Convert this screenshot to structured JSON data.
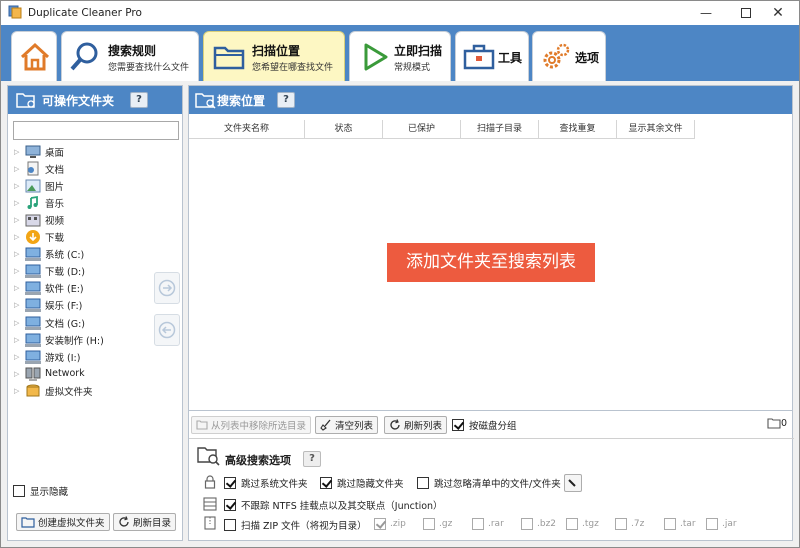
{
  "window": {
    "title": "Duplicate Cleaner Pro"
  },
  "tabs": [
    {
      "title": "搜索规则",
      "subtitle": "您需要查找什么文件"
    },
    {
      "title": "扫描位置",
      "subtitle": "您希望在哪查找文件"
    },
    {
      "title": "立即扫描",
      "subtitle": "常规模式"
    },
    {
      "title": "工具",
      "subtitle": ""
    },
    {
      "title": "选项",
      "subtitle": ""
    }
  ],
  "left_panel": {
    "title": "可操作文件夹",
    "help": "?",
    "tree": [
      {
        "label": "桌面",
        "icon": "desktop-icon"
      },
      {
        "label": "文档",
        "icon": "documents-icon"
      },
      {
        "label": "图片",
        "icon": "pictures-icon"
      },
      {
        "label": "音乐",
        "icon": "music-icon"
      },
      {
        "label": "视频",
        "icon": "video-icon"
      },
      {
        "label": "下载",
        "icon": "download-icon"
      },
      {
        "label": "系统 (C:)",
        "icon": "drive-icon"
      },
      {
        "label": "下载 (D:)",
        "icon": "drive-icon"
      },
      {
        "label": "软件 (E:)",
        "icon": "drive-icon"
      },
      {
        "label": "娱乐 (F:)",
        "icon": "drive-icon"
      },
      {
        "label": "文档 (G:)",
        "icon": "drive-icon"
      },
      {
        "label": "安装制作 (H:)",
        "icon": "drive-icon"
      },
      {
        "label": "游戏 (I:)",
        "icon": "drive-icon"
      },
      {
        "label": "Network",
        "icon": "network-icon"
      },
      {
        "label": "虚拟文件夹",
        "icon": "virtual-folder-icon"
      }
    ],
    "show_hidden": "显示隐藏",
    "create_virtual": "创建虚拟文件夹",
    "refresh_dir": "刷新目录"
  },
  "right_panel": {
    "title": "搜索位置",
    "help": "?",
    "columns": [
      "文件夹名称",
      "状态",
      "已保护",
      "扫描子目录",
      "查找重复",
      "显示其余文件"
    ],
    "empty_hint": "添加文件夹至搜索列表"
  },
  "list_toolbar": {
    "remove_selected": "从列表中移除所选目录",
    "clear_list": "清空列表",
    "refresh_list": "刷新列表",
    "group_by_disk": "按磁盘分组",
    "count": "0"
  },
  "advanced": {
    "title": "高级搜索选项",
    "help": "?",
    "skip_system": "跳过系统文件夹",
    "skip_hidden": "跳过隐藏文件夹",
    "skip_ignore_list": "跳过忽略清单中的文件/文件夹",
    "ntfs": "不跟踪 NTFS 挂载点以及其交联点（Junction）",
    "scan_zip": "扫描 ZIP 文件（将视为目录）",
    "exts": [
      ".zip",
      ".gz",
      ".rar",
      ".bz2",
      ".tgz",
      ".7z",
      ".tar",
      ".jar"
    ]
  },
  "colors": {
    "accent": "#4d86c5",
    "active_tab": "#fdf7c3",
    "banner": "#ed5b3f"
  }
}
